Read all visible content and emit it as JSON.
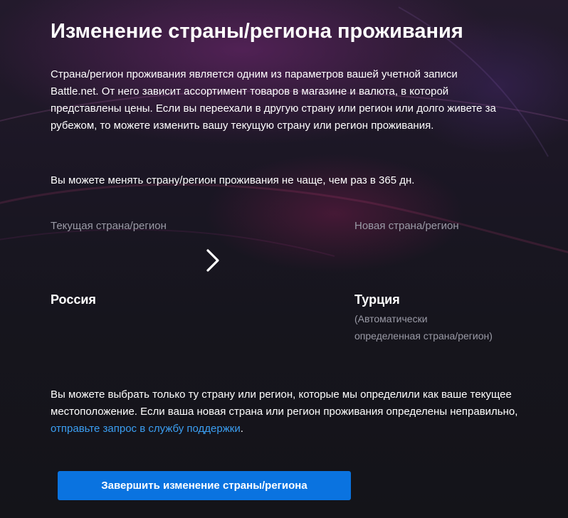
{
  "page": {
    "title": "Изменение страны/региона проживания"
  },
  "intro": {
    "text": "Страна/регион проживания является одним из параметров вашей учетной записи Battle.net. От него зависит ассортимент товаров в магазине и валюта, в которой представлены цены. Если вы переехали в другую страну или регион или долго живете за рубежом, то можете изменить вашу текущую страну или регион проживания."
  },
  "limit": {
    "text": "Вы можете менять страну/регион проживания не чаще, чем раз в 365 дн."
  },
  "current": {
    "label": "Текущая страна/регион",
    "value": "Россия"
  },
  "arrow_icon": "chevron-right-icon",
  "new": {
    "label": "Новая страна/регион",
    "value": "Турция",
    "note_line1": "(Автоматически",
    "note_line2": "определенная страна/регион)"
  },
  "footer": {
    "text_before": "Вы можете выбрать только ту страну или регион, которые мы определили как ваше текущее местоположение. Если ваша новая страна или регион проживания определены неправильно, ",
    "link_label": "отправьте запрос в службу поддержки",
    "text_after": "."
  },
  "button": {
    "label": "Завершить изменение страны/региона"
  },
  "colors": {
    "accent": "#0a73e0",
    "link": "#3b9ef2",
    "muted_text": "#9a9aa6",
    "background": "#15151c"
  }
}
